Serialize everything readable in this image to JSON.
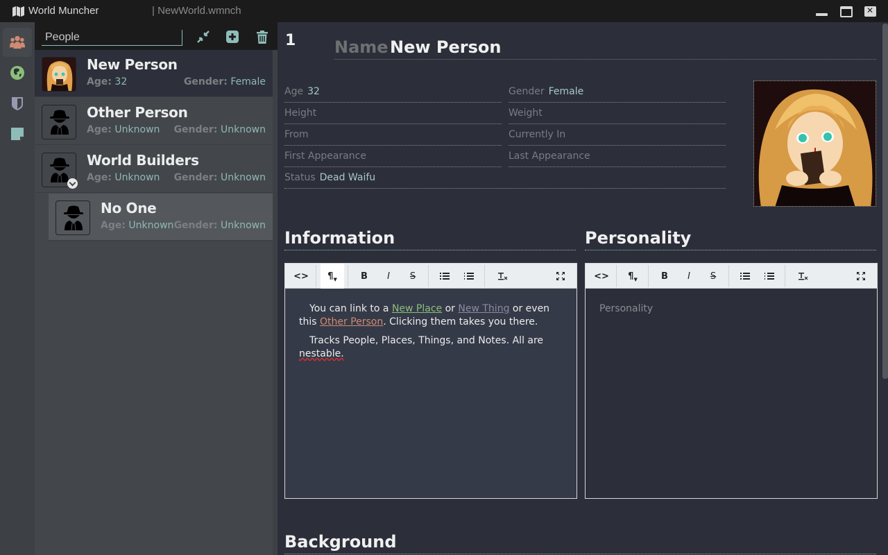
{
  "window": {
    "app_title": "World Muncher",
    "file_title": "| NewWorld.wmnch",
    "icons": {
      "app": "map-icon",
      "minimize": "minimize-icon",
      "maximize": "maximize-icon",
      "close": "close-icon"
    }
  },
  "rail": {
    "items": [
      {
        "name": "People",
        "icon": "people-icon",
        "color": "#d18a72",
        "active": true
      },
      {
        "name": "Places",
        "icon": "globe-icon",
        "color": "#8cbf7a",
        "active": false
      },
      {
        "name": "Things",
        "icon": "shield-icon",
        "color": "#9a98b0",
        "active": false
      },
      {
        "name": "Notes",
        "icon": "note-icon",
        "color": "#8fbcb9",
        "active": false
      }
    ]
  },
  "list": {
    "search_value": "People",
    "buttons": {
      "collapse": "collapse-icon",
      "add": "add-icon",
      "delete": "trash-icon"
    },
    "age_label": "Age:",
    "gender_label": "Gender:",
    "items": [
      {
        "name": "New Person",
        "age": "32",
        "gender": "Female",
        "avatar": "portrait",
        "selected": true
      },
      {
        "name": "Other Person",
        "age": "Unknown",
        "gender": "Unknown",
        "avatar": "spy-icon"
      },
      {
        "name": "World Builders",
        "age": "Unknown",
        "gender": "Unknown",
        "avatar": "spy-icon",
        "expanded": true
      },
      {
        "name": "No One",
        "age": "Unknown",
        "gender": "Unknown",
        "avatar": "spy-icon",
        "child": true
      }
    ]
  },
  "detail": {
    "id": "1",
    "name_label": "Name",
    "name_value": "New Person",
    "fields": {
      "age": {
        "label": "Age",
        "value": "32"
      },
      "gender": {
        "label": "Gender",
        "value": "Female"
      },
      "height": {
        "label": "Height",
        "value": ""
      },
      "weight": {
        "label": "Weight",
        "value": ""
      },
      "from": {
        "label": "From",
        "value": ""
      },
      "currently_in": {
        "label": "Currently In",
        "value": ""
      },
      "first_appearance": {
        "label": "First Appearance",
        "value": ""
      },
      "last_appearance": {
        "label": "Last Appearance",
        "value": ""
      },
      "status": {
        "label": "Status",
        "value": "Dead Waifu"
      }
    },
    "sections": {
      "information": {
        "title": "Information",
        "p1_a": "You can link to a ",
        "link_place": "New Place",
        "p1_b": " or ",
        "link_thing": "New Thing",
        "p1_c": " or even this ",
        "link_person": "Other Person",
        "p1_d": ". Clicking them takes you there.",
        "p2_a": "Tracks People, Places, Things, and Notes. All are ",
        "p2_b": "nestable."
      },
      "personality": {
        "title": "Personality",
        "placeholder": "Personality"
      },
      "background": {
        "title": "Background"
      }
    },
    "toolbar": {
      "code": "<>",
      "paragraph": "¶",
      "bold": "B",
      "italic": "I",
      "strike": "S",
      "bullet_list": "bulleted-list-icon",
      "ordered_list": "numbered-list-icon",
      "clear_format": "clear-format-icon",
      "fullscreen": "fullscreen-icon"
    }
  }
}
